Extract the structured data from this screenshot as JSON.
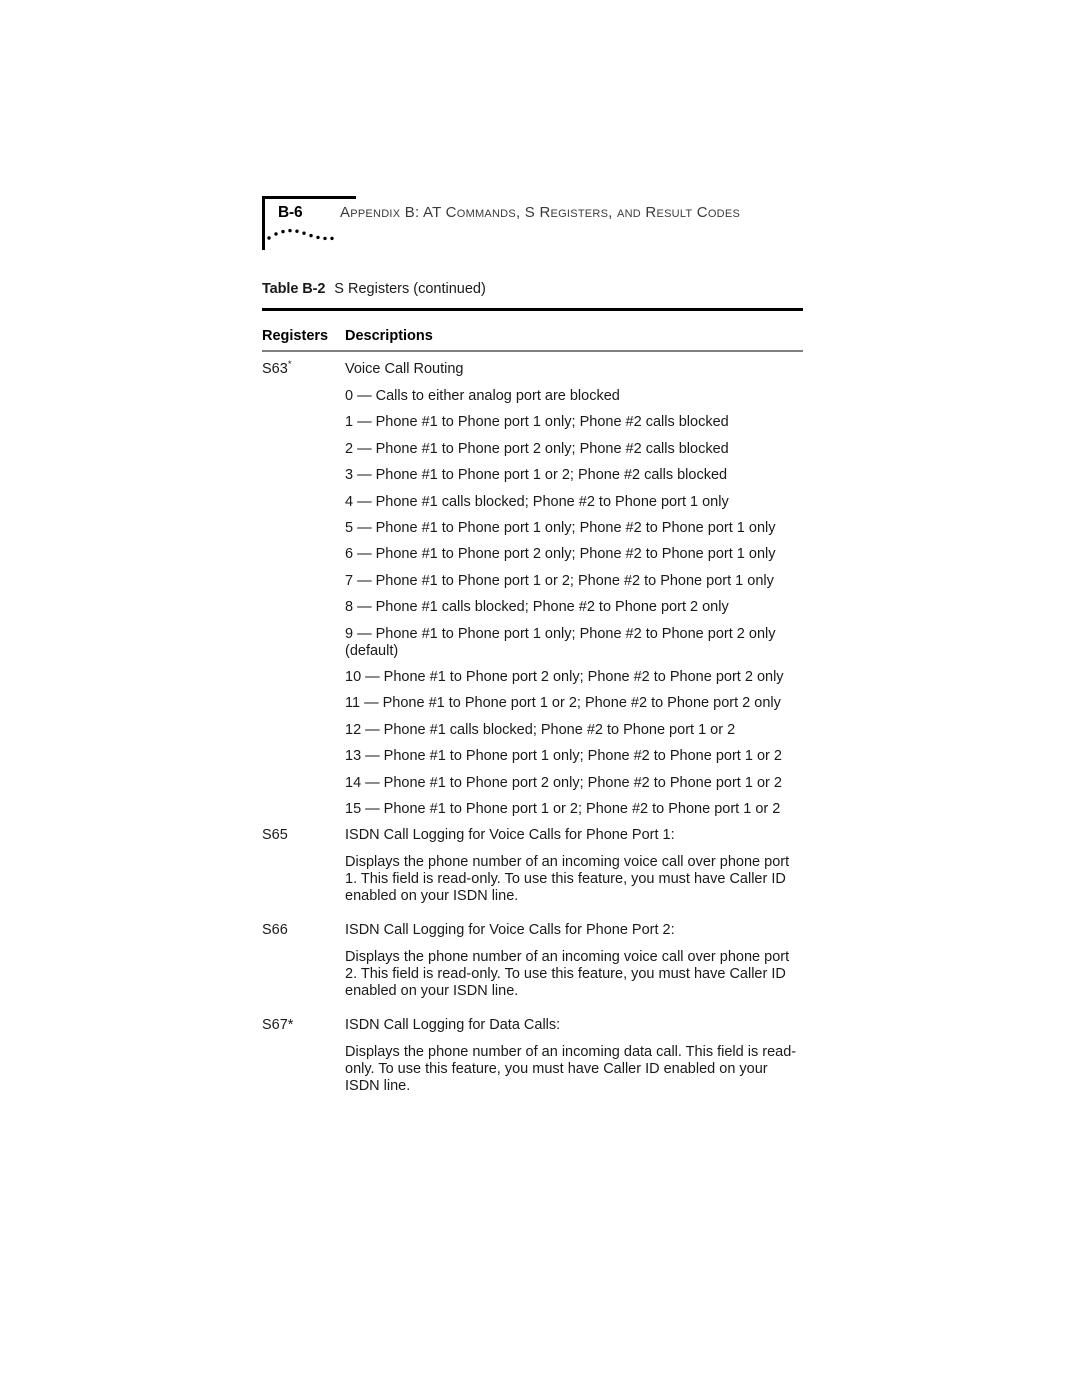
{
  "page": {
    "folio": "B-6",
    "running_header": "Appendix B: AT Commands, S Registers, and Result Codes"
  },
  "table": {
    "caption_label": "Table B-2",
    "caption_title": "S Registers (continued)",
    "columns": {
      "registers": "Registers",
      "descriptions": "Descriptions"
    },
    "rows": [
      {
        "register": "S63",
        "register_marker": "*",
        "title": "Voice Call Routing",
        "options": [
          "0 — Calls to either analog port are blocked",
          "1 — Phone #1 to Phone port 1 only; Phone #2 calls blocked",
          "2 — Phone #1 to Phone port 2 only; Phone #2 calls blocked",
          "3 — Phone #1 to Phone port 1 or 2; Phone #2 calls blocked",
          "4 — Phone #1 calls blocked; Phone #2 to Phone port 1 only",
          "5 — Phone #1 to Phone port 1 only; Phone #2 to Phone port 1 only",
          "6 — Phone #1 to Phone port 2 only; Phone #2 to Phone port 1 only",
          "7 — Phone #1 to Phone port 1 or 2; Phone #2 to Phone port 1 only",
          "8 — Phone #1 calls blocked; Phone #2 to Phone port 2 only",
          "9 — Phone #1 to Phone port 1 only; Phone #2 to Phone port 2 only (default)",
          "10 — Phone #1 to Phone port 2 only; Phone #2 to Phone port 2 only",
          "11 — Phone #1 to Phone port 1 or 2; Phone #2 to Phone port 2 only",
          "12 — Phone #1 calls blocked; Phone #2 to Phone port 1 or 2",
          "13 — Phone #1 to Phone port 1 only; Phone #2 to Phone port 1 or 2",
          "14 — Phone #1 to Phone port 2 only; Phone #2 to Phone port 1 or 2",
          "15 — Phone #1 to Phone port 1 or 2; Phone #2 to Phone port 1 or 2"
        ]
      },
      {
        "register": "S65",
        "register_marker": "",
        "title": "ISDN Call Logging for Voice Calls for Phone Port 1:",
        "body": "Displays the phone number of an incoming voice call over phone port 1. This field is read-only. To use this feature, you must have Caller ID enabled on your ISDN line."
      },
      {
        "register": "S66",
        "register_marker": "",
        "title": "ISDN Call Logging for Voice Calls for Phone Port 2:",
        "body": "Displays the phone number of an incoming voice call over phone port 2. This field is read-only. To use this feature, you must have Caller ID enabled on your ISDN line."
      },
      {
        "register": "S67*",
        "register_marker": "",
        "title": "ISDN Call Logging for Data Calls:",
        "body": "Displays the phone number of an incoming data call. This field is read-only. To use this feature, you must have Caller ID enabled on your ISDN line."
      }
    ]
  },
  "colors": {
    "rule_thick": "#000000",
    "rule_thin": "#808080",
    "text": "#1a1a1a",
    "header_text": "#3a3a3a",
    "page_background": "#ffffff"
  }
}
